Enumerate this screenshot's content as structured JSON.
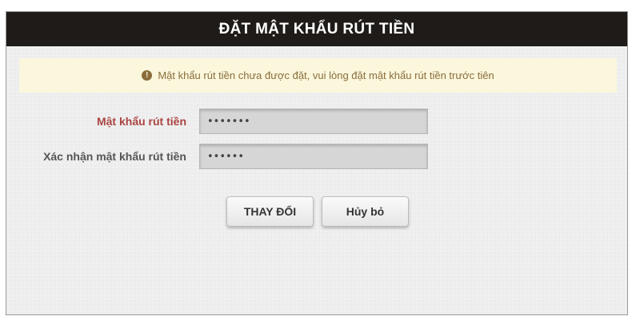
{
  "dialog": {
    "title": "ĐẶT MẬT KHẨU RÚT TIỀN"
  },
  "notice": {
    "icon": "exclamation-circle-icon",
    "icon_glyph": "!",
    "text": "Mật khẩu rút tiền chưa được đặt, vui lòng đặt mật khẩu rút tiền trước tiên",
    "color": "#8a6d3b",
    "background": "#fbf7dd"
  },
  "form": {
    "password": {
      "label": "Mật khẩu rút tiền",
      "value": "1234567",
      "label_color": "#a94442"
    },
    "confirm_password": {
      "label": "Xác nhận mật khẩu rút tiền",
      "value": "123456"
    }
  },
  "actions": {
    "submit_label": "THAY ĐỔI",
    "cancel_label": "Hủy bỏ"
  },
  "colors": {
    "header_bg": "#1f1b18",
    "panel_bg": "#efefef"
  }
}
